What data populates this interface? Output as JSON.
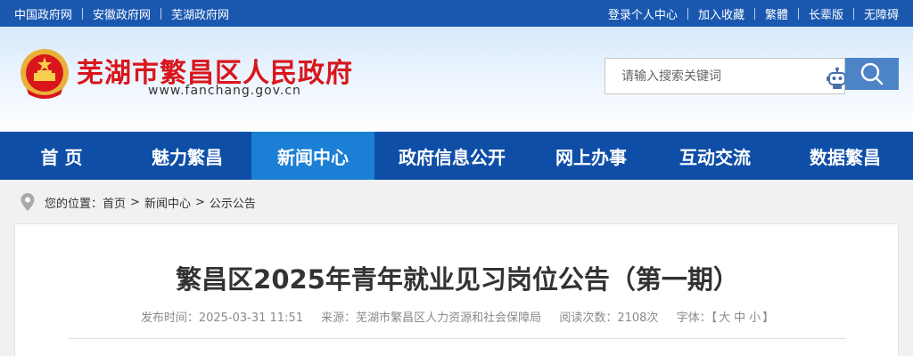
{
  "topbar": {
    "left_links": [
      "中国政府网",
      "安徽政府网",
      "芜湖政府网"
    ],
    "right_links": [
      "登录个人中心",
      "加入收藏",
      "繁體",
      "长辈版",
      "无障碍"
    ]
  },
  "header": {
    "site_title": "芜湖市繁昌区人民政府",
    "site_url": "www.fanchang.gov.cn",
    "emblem_icon": "national-emblem-icon",
    "search_placeholder": "请输入搜索关键词",
    "search_icon": "search-icon",
    "assistant_icon": "robot-icon"
  },
  "nav": {
    "items": [
      "首 页",
      "魅力繁昌",
      "新闻中心",
      "政府信息公开",
      "网上办事",
      "互动交流",
      "数据繁昌"
    ],
    "active_index": 2
  },
  "breadcrumb": {
    "prefix": "您的位置：",
    "items": [
      "首页",
      "新闻中心",
      "公示公告"
    ],
    "separator": ">"
  },
  "article": {
    "title": "繁昌区2025年青年就业见习岗位公告（第一期）",
    "publish_label": "发布时间：",
    "publish_time": "2025-03-31 11:51",
    "source_label": "来源：",
    "source": "芜湖市繁昌区人力资源和社会保障局",
    "views_label": "阅读次数：",
    "views": "2108次",
    "fontsize_label": "字体：",
    "fontsize_open": "【",
    "fontsize_options": [
      "大",
      "中",
      "小"
    ],
    "fontsize_close": "】"
  },
  "colors": {
    "topbar": "#1a58b0",
    "nav": "#0e4ea7",
    "nav_active": "#1a7fd5",
    "title_red": "#d9161c",
    "search_button": "#4d84c8"
  }
}
